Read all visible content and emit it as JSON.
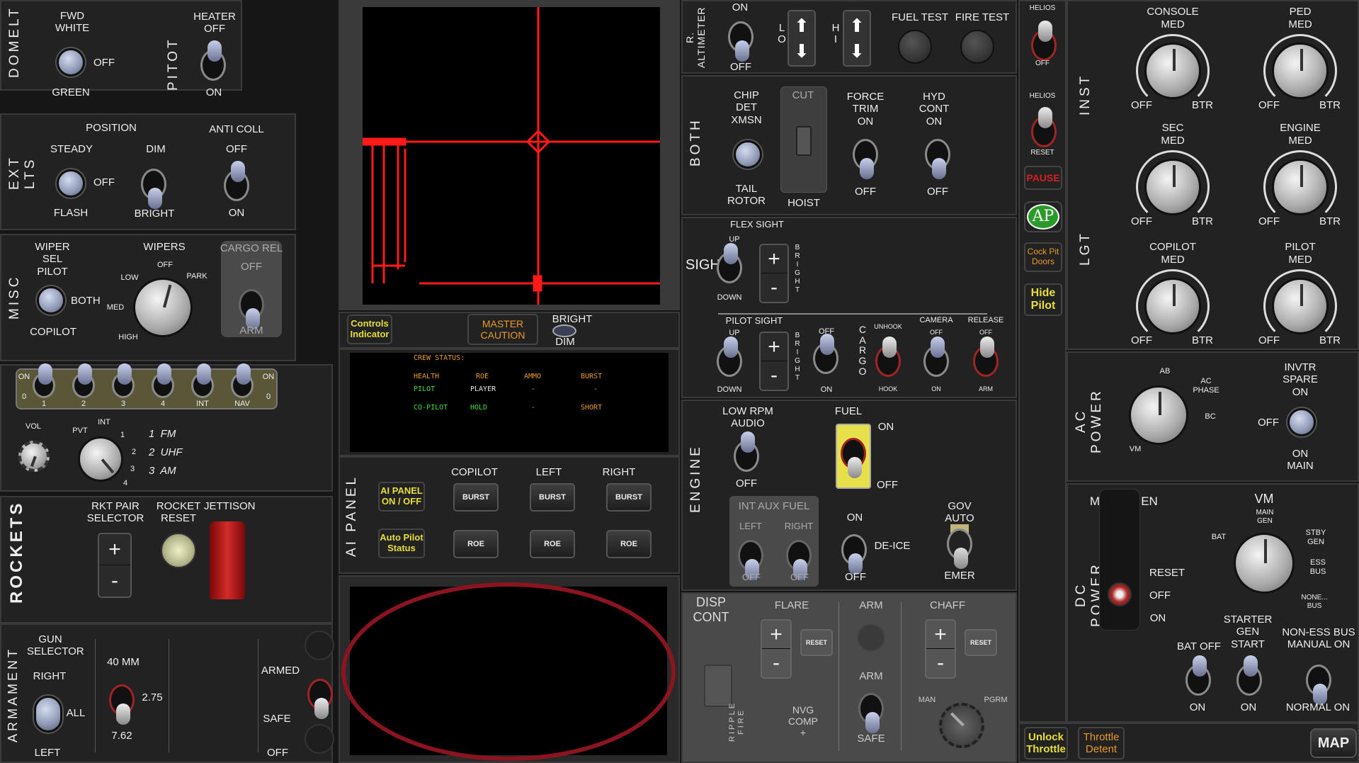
{
  "domelt": {
    "title": "DOMELT",
    "fwd_white": "FWD\nWHITE",
    "off": "OFF",
    "green": "GREEN"
  },
  "pitot": {
    "title": "PITOT",
    "heater_off": "HEATER\nOFF",
    "on": "ON"
  },
  "extlts": {
    "title": "EXT LTS",
    "position": "POSITION",
    "steady": "STEADY",
    "off": "OFF",
    "flash": "FLASH",
    "dim": "DIM",
    "bright": "BRIGHT",
    "anti_coll": "ANTI COLL",
    "anti_off": "OFF",
    "anti_on": "ON"
  },
  "misc": {
    "title": "MISC",
    "wiper_sel": "WIPER\nSEL\nPILOT",
    "both": "BOTH",
    "copilot": "COPILOT",
    "wipers": "WIPERS",
    "off": "OFF",
    "low": "LOW",
    "park": "PARK",
    "med": "MED",
    "high": "HIGH",
    "cargo_rel": "CARGO REL",
    "cargo_off": "OFF",
    "cargo_arm": "ARM"
  },
  "radio": {
    "switches": [
      "1",
      "2",
      "3",
      "4",
      "INT",
      "NAV"
    ],
    "on_left": "ON",
    "zero_left": "0",
    "on_right": "ON",
    "zero_right": "0",
    "vol": "VOL",
    "pvt": "PVT",
    "int": "INT",
    "s1": "1",
    "s2": "2",
    "s3": "3",
    "s4": "4",
    "fm": "1  FM",
    "uhf": "2  UHF",
    "am": "3  AM"
  },
  "rockets": {
    "title": "ROCKETS",
    "pair_selector": "RKT PAIR\nSELECTOR",
    "rocket_reset": "ROCKET\nRESET",
    "jettison": "JETTISON"
  },
  "armament": {
    "title": "ARMAMENT",
    "gun_selector": "GUN\nSELECTOR",
    "right": "RIGHT",
    "all": "ALL",
    "left": "LEFT",
    "mm40": "40 MM",
    "c275": "2.75",
    "c762": "7.62",
    "armed": "ARMED",
    "safe": "SAFE",
    "off": "OFF"
  },
  "center": {
    "controls_indicator": "Controls\nIndicator",
    "master_caution": "MASTER\nCAUTION",
    "bright": "BRIGHT",
    "dim": "DIM"
  },
  "crew": {
    "title": "CREW STATUS:",
    "headers": [
      "HEALTH",
      "ROE",
      "AMMO",
      "BURST"
    ],
    "rows": [
      {
        "name": "PILOT",
        "roe": "PLAYER",
        "ammo": "-",
        "burst": "-"
      },
      {
        "name": "CO-PILOT",
        "roe": "HOLD",
        "ammo": "-",
        "burst": "SHORT"
      }
    ]
  },
  "aipanel": {
    "title": "AI PANEL",
    "copilot": "COPILOT",
    "left": "LEFT",
    "right": "RIGHT",
    "ai_panel_btn": "AI PANEL\nON / OFF",
    "auto_pilot_status": "Auto Pilot\nStatus",
    "burst": "BURST",
    "roe": "ROE"
  },
  "altimeter": {
    "title": "R. ALTIMETER",
    "on": "ON",
    "off": "OFF",
    "lo": "L\nO",
    "hi": "H\nI",
    "fuel_test": "FUEL TEST",
    "fire_test": "FIRE TEST"
  },
  "both": {
    "title": "BOTH",
    "chip_det": "CHIP\nDET\nXMSN",
    "tail_rotor": "TAIL\nROTOR",
    "cut": "CUT",
    "hoist": "HOIST",
    "force_trim": "FORCE\nTRIM\nON",
    "ft_off": "OFF",
    "hyd_cont": "HYD\nCONT\nON",
    "hyd_off": "OFF"
  },
  "sights": {
    "title": "SIGHTS",
    "flex_sight": "FLEX SIGHT",
    "up": "UP",
    "down": "DOWN",
    "bright": "B\nR\nI\nG\nH\nT",
    "pilot_sight": "PILOT SIGHT",
    "ps_up": "UP",
    "ps_down": "DOWN",
    "off": "OFF",
    "on": "ON",
    "cargo": "C\nA\nR\nG\nO",
    "unhook": "UNHOOK",
    "hook": "HOOK",
    "camera": "CAMERA",
    "cam_off": "OFF",
    "cam_on": "ON",
    "release": "RELEASE",
    "rel_off": "OFF",
    "rel_arm": "ARM"
  },
  "engine": {
    "title": "ENGINE",
    "low_rpm": "LOW RPM\nAUDIO",
    "lr_off": "OFF",
    "fuel": "FUEL",
    "fuel_on": "ON",
    "fuel_off": "OFF",
    "int_aux": "INT AUX FUEL",
    "left": "LEFT",
    "right": "RIGHT",
    "l_off": "OFF",
    "r_off": "OFF",
    "deice_on": "ON",
    "deice": "DE-ICE",
    "deice_off": "OFF",
    "gov_auto": "GOV\nAUTO",
    "emer": "EMER"
  },
  "dispcont": {
    "title": "DISP\nCONT",
    "flare": "FLARE",
    "arm": "ARM",
    "chaff": "CHAFF",
    "reset": "RESET",
    "arm2": "ARM",
    "safe": "SAFE",
    "nvg": "NVG\nCOMP\n+",
    "ripple": "RIPPLE\nFIRE",
    "man": "MAN",
    "pgrm": "PGRM"
  },
  "strip": {
    "helios1": "HELIOS",
    "h1_off": "OFF",
    "helios2": "HELIOS",
    "h2_reset": "RESET",
    "pause": "PAUSE",
    "ap": "AP",
    "cockpit_doors": "Cock Pit\nDoors",
    "hide_pilot": "Hide\nPilot"
  },
  "inst": {
    "title_inst": "INST",
    "title_lgt": "LGT",
    "knobs": [
      {
        "name": "CONSOLE"
      },
      {
        "name": "PED"
      },
      {
        "name": "SEC"
      },
      {
        "name": "ENGINE"
      },
      {
        "name": "COPILOT"
      },
      {
        "name": "PILOT"
      }
    ],
    "med": "MED",
    "off": "OFF",
    "btr": "BTR"
  },
  "acpower": {
    "title": "AC POWER",
    "ab": "AB",
    "ac": "AC\nPHASE",
    "bc": "BC",
    "vm": "VM",
    "invtr": "INVTR\nSPARE\nON",
    "off": "OFF",
    "on_main": "ON\nMAIN"
  },
  "dcpower": {
    "title": "DC POWER",
    "m": "M",
    "en": "EN",
    "reset": "RESET",
    "off": "OFF",
    "on": "ON",
    "vm": "VM",
    "bat": "BAT",
    "main_gen": "MAIN\nGEN",
    "stby_gen": "STBY\nGEN",
    "ess_bus": "ESS\nBUS",
    "none_bus": "NONE...\nBUS",
    "bat_off": "BAT OFF",
    "bat_on": "ON",
    "starter": "STARTER\nGEN\nSTART",
    "st_on": "ON",
    "non_ess": "NON-ESS BUS\nMANUAL ON",
    "normal_on": "NORMAL ON"
  },
  "bottom": {
    "unlock_throttle": "Unlock\nThrottle",
    "throttle_detent": "Throttle\nDetent",
    "map": "MAP"
  }
}
